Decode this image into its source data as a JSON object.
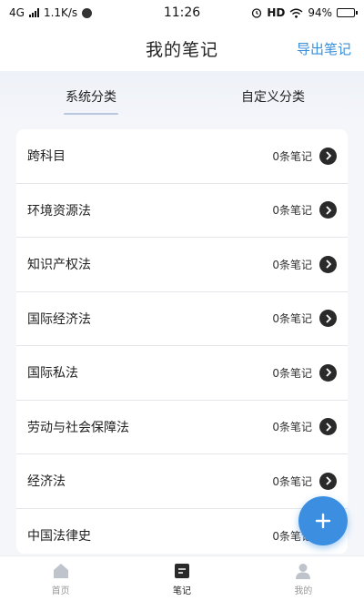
{
  "status_bar": {
    "network": "4G",
    "speed": "1.1K/s",
    "time": "11:26",
    "hd": "HD",
    "battery": "94%",
    "battery_level": 0.94
  },
  "header": {
    "title": "我的笔记",
    "action_label": "导出笔记",
    "accent_color": "#3a8fd8"
  },
  "tabs": [
    {
      "label": "系统分类",
      "active": true
    },
    {
      "label": "自定义分类",
      "active": false
    }
  ],
  "categories": [
    {
      "label": "跨科目",
      "count": "0条笔记"
    },
    {
      "label": "环境资源法",
      "count": "0条笔记"
    },
    {
      "label": "知识产权法",
      "count": "0条笔记"
    },
    {
      "label": "国际经济法",
      "count": "0条笔记"
    },
    {
      "label": "国际私法",
      "count": "0条笔记"
    },
    {
      "label": "劳动与社会保障法",
      "count": "0条笔记"
    },
    {
      "label": "经济法",
      "count": "0条笔记"
    },
    {
      "label": "中国法律史",
      "count": "0条笔记"
    }
  ],
  "fab": {
    "icon": "plus-icon",
    "color": "#3b8ee0"
  },
  "bottom_nav": [
    {
      "label": "首页",
      "icon": "home-icon",
      "active": false
    },
    {
      "label": "笔记",
      "icon": "note-icon",
      "active": true
    },
    {
      "label": "我的",
      "icon": "user-icon",
      "active": false
    }
  ]
}
